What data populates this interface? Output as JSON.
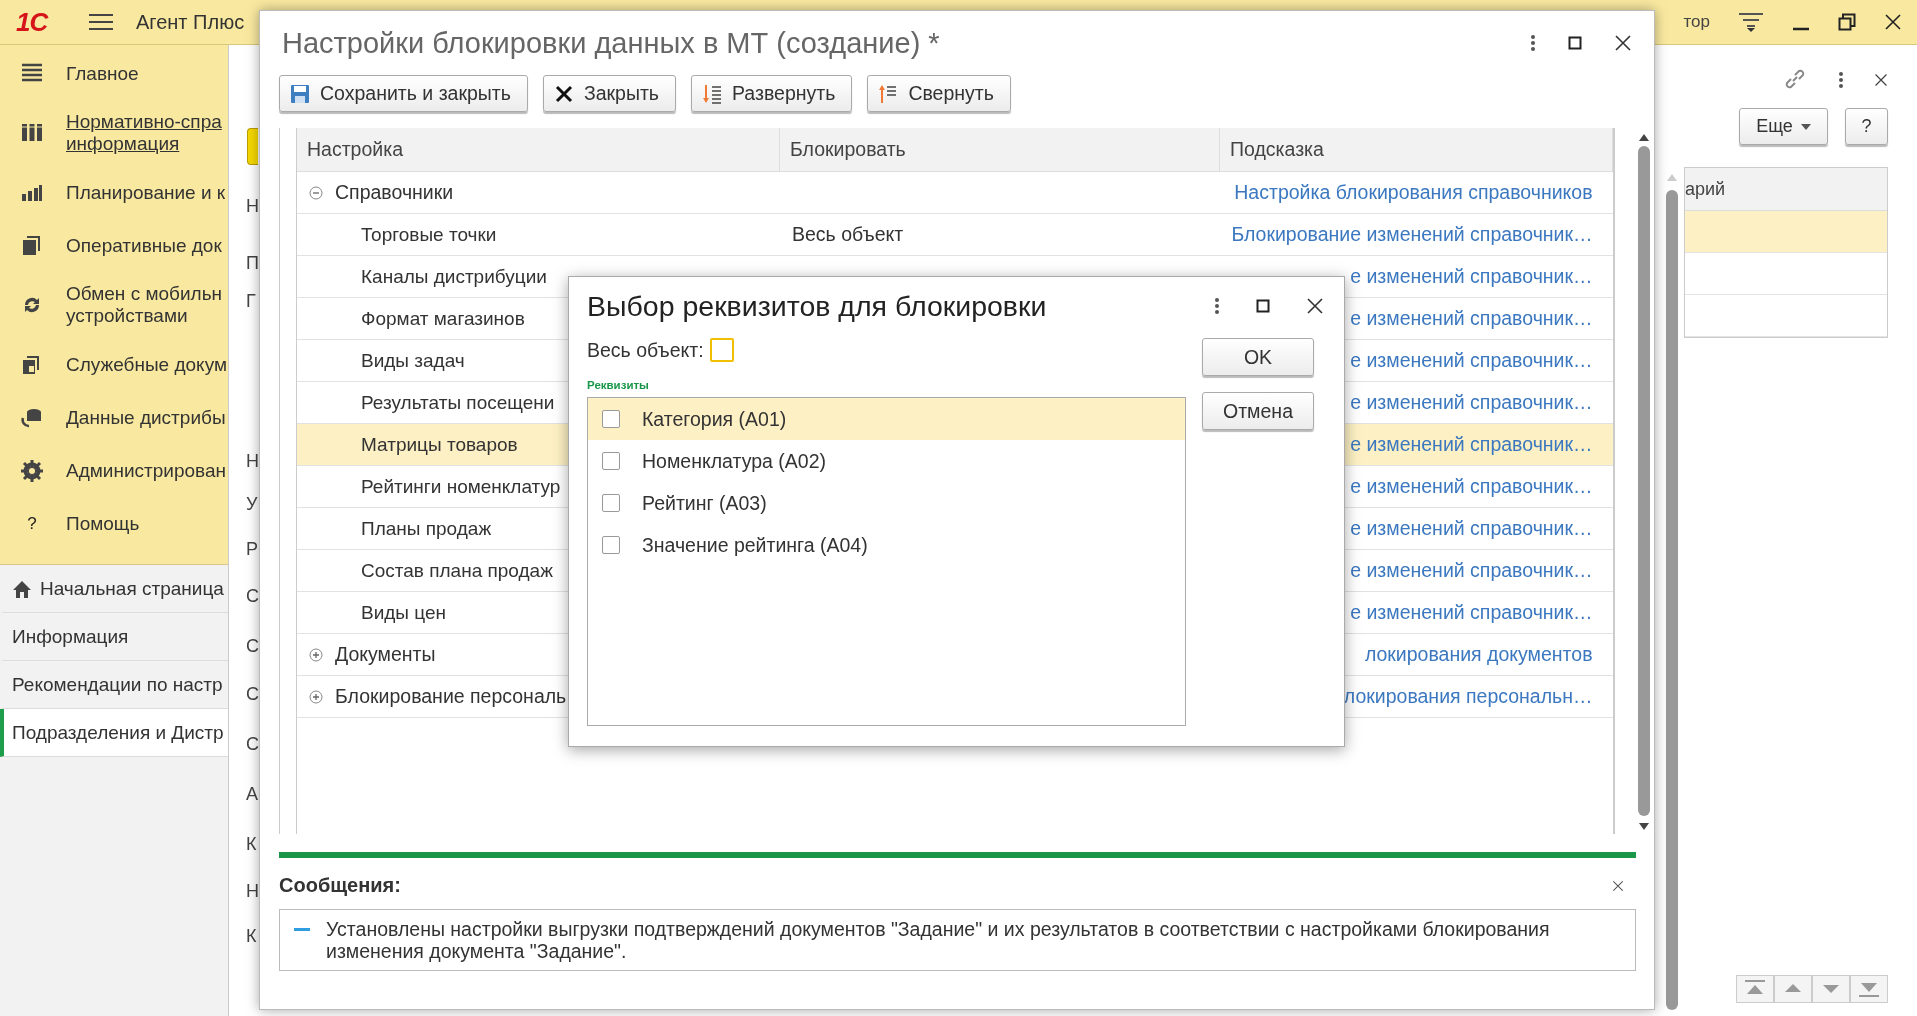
{
  "app_bar": {
    "logo": "1С",
    "title": "Агент Плюс",
    "user": "тор"
  },
  "sections": [
    {
      "lines": [
        "Главное"
      ],
      "kind": "main",
      "selected": false
    },
    {
      "lines": [
        "Нормативно-спра",
        "информация"
      ],
      "kind": "catalog",
      "selected": true
    },
    {
      "lines": [
        "Планирование и к"
      ],
      "kind": "chart",
      "selected": false
    },
    {
      "lines": [
        "Оперативные док"
      ],
      "kind": "docs",
      "selected": false
    },
    {
      "lines": [
        "Обмен с мобильн",
        "устройствами"
      ],
      "kind": "sync",
      "selected": false
    },
    {
      "lines": [
        "Служебные докум"
      ],
      "kind": "service",
      "selected": false
    },
    {
      "lines": [
        "Данные дистрибы"
      ],
      "kind": "data",
      "selected": false
    },
    {
      "lines": [
        "Администрирован"
      ],
      "kind": "gear",
      "selected": false
    },
    {
      "lines": [
        "Помощь"
      ],
      "kind": "help",
      "icon": "?",
      "selected": false
    }
  ],
  "open_windows": [
    {
      "label": "Начальная страница",
      "kind": "home",
      "selected": false
    },
    {
      "label": "Информация",
      "kind": "plain",
      "selected": false
    },
    {
      "label": "Рекомендации по настр",
      "kind": "plain",
      "selected": false
    },
    {
      "label": "Подразделения и Дистр",
      "kind": "plain",
      "selected": true
    }
  ],
  "background_form": {
    "labels": [
      "Н",
      "П",
      "Г",
      "Н",
      "У",
      "Р",
      "С",
      "С",
      "С",
      "С",
      "А",
      "К",
      "Н",
      "К"
    ]
  },
  "right_panel": {
    "more_button": "Еще",
    "help_button": "?",
    "table": {
      "column": "арий",
      "rows": [
        {
          "selected": true
        },
        {
          "selected": false
        },
        {
          "selected": false
        }
      ]
    }
  },
  "main_window": {
    "title": "Настройки блокировки данных в МТ (создание) *",
    "toolbar": [
      {
        "label": "Сохранить и закрыть",
        "kind": "save"
      },
      {
        "label": "Закрыть",
        "kind": "close"
      },
      {
        "label": "Развернуть",
        "kind": "expand"
      },
      {
        "label": "Свернуть",
        "kind": "collapse"
      }
    ],
    "table": {
      "columns": [
        "Настройка",
        "Блокировать",
        "Подсказка"
      ],
      "rows": [
        {
          "setting": "Справочники",
          "hint": "Настройка блокирования справочников",
          "expanded": true,
          "selected": false,
          "children": [
            {
              "setting": "Торговые точки",
              "block": "Весь объект",
              "hint": "Блокирование изменений справочник…",
              "selected": false
            },
            {
              "setting": "Каналы дистрибуции",
              "hint": "е изменений справочник…",
              "selected": false
            },
            {
              "setting": "Формат магазинов",
              "hint": "е изменений справочник…",
              "selected": false
            },
            {
              "setting": "Виды задач",
              "hint": "е изменений справочник…",
              "selected": false
            },
            {
              "setting": "Результаты посещени",
              "hint": "е изменений справочник…",
              "selected": false
            },
            {
              "setting": "Матрицы товаров",
              "hint": "е изменений справочник…",
              "selected": true
            },
            {
              "setting": "Рейтинги номенклатур",
              "hint": "е изменений справочник…",
              "selected": false
            },
            {
              "setting": "Планы продаж",
              "hint": "е изменений справочник…",
              "selected": false
            },
            {
              "setting": "Состав плана продаж",
              "hint": "е изменений справочник…",
              "selected": false
            },
            {
              "setting": "Виды цен",
              "hint": "е изменений справочник…",
              "selected": false
            }
          ]
        },
        {
          "setting": "Документы",
          "hint": "локирования документов",
          "expanded": false,
          "selected": false
        },
        {
          "setting": "Блокирование персональ",
          "hint": "локирования персональн…",
          "expanded": false,
          "selected": false
        }
      ]
    },
    "messages": {
      "title": "Сообщения:",
      "items": [
        "Установлены настройки выгрузки подтверждений документов \"Задание\" и их результатов в соответствии с настройками блокирования изменения документа \"Задание\"."
      ]
    }
  },
  "dialog": {
    "title": "Выбор реквизитов для блокировки",
    "whole_object": {
      "label": "Весь объект:",
      "checked": false
    },
    "group_label": "Реквизиты",
    "attributes": [
      {
        "label": "Категория (A01)",
        "checked": false,
        "selected": true
      },
      {
        "label": "Номенклатура (A02)",
        "checked": false,
        "selected": false
      },
      {
        "label": "Рейтинг (A03)",
        "checked": false,
        "selected": false
      },
      {
        "label": "Значение рейтинга (A04)",
        "checked": false,
        "selected": false
      }
    ],
    "buttons": [
      "OK",
      "Отмена"
    ]
  }
}
